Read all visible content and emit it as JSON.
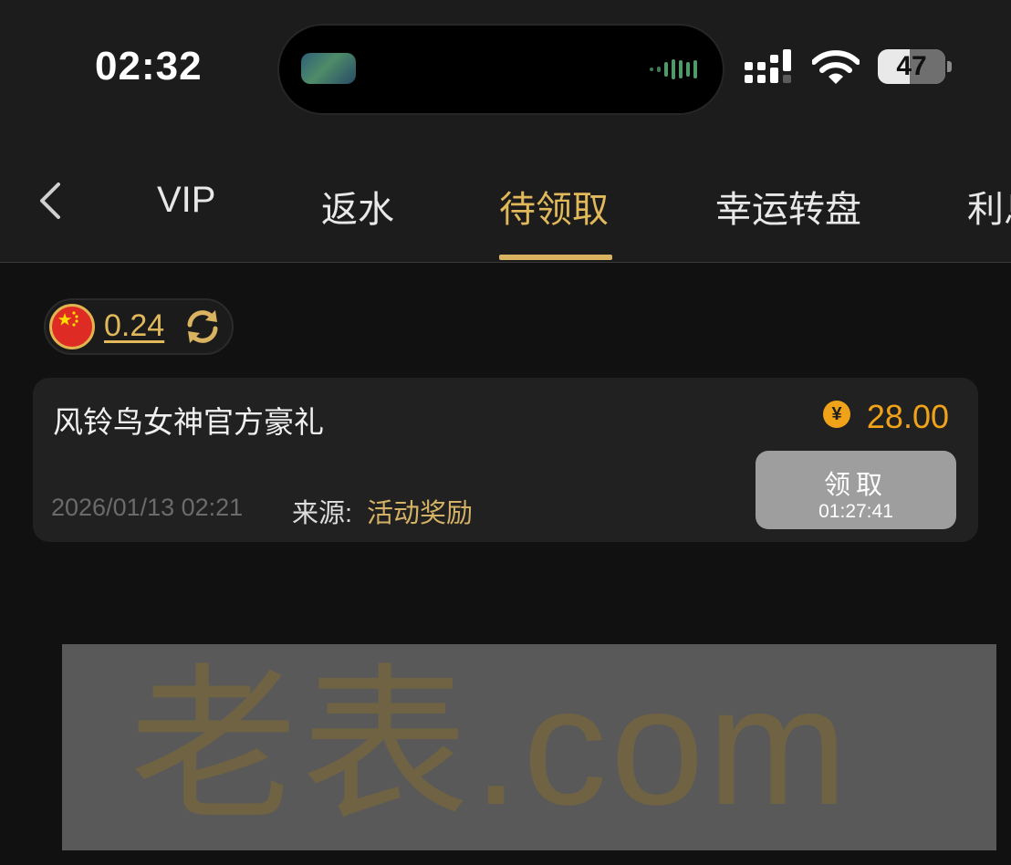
{
  "status_bar": {
    "time": "02:32",
    "battery_level": "47",
    "icons": [
      "cellular-signal-icon",
      "wifi-icon",
      "battery-icon"
    ]
  },
  "nav": {
    "back_icon": "chevron-left-icon",
    "tabs": [
      {
        "label": "VIP",
        "active": false
      },
      {
        "label": "返水",
        "active": false
      },
      {
        "label": "待领取",
        "active": true
      },
      {
        "label": "幸运转盘",
        "active": false
      },
      {
        "label": "利息",
        "active": false
      }
    ]
  },
  "balance": {
    "currency_icon": "china-flag-icon",
    "value": "0.24",
    "refresh_icon": "refresh-icon"
  },
  "rewards": [
    {
      "title": "风铃鸟女神官方豪礼",
      "amount": "28.00",
      "amount_icon": "¥",
      "date": "2026/01/13 02:21",
      "source_label": "来源:",
      "source_value": "活动奖励",
      "claim_label": "领取",
      "countdown": "01:27:41"
    }
  ],
  "watermark": {
    "text": "老表.com"
  },
  "colors": {
    "accent_gold": "#e1b95b",
    "amount_orange": "#f0a319",
    "background": "#111111",
    "card": "#212121",
    "claim_button_disabled": "#9e9e9e"
  }
}
